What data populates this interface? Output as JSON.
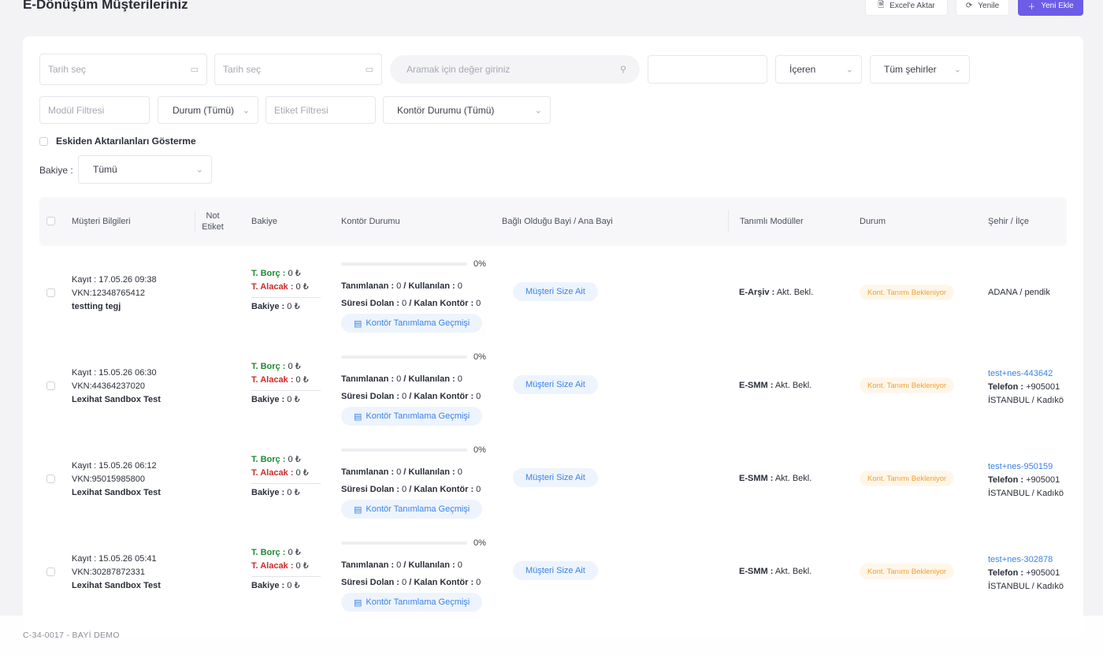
{
  "header": {
    "title": "E-Dönüşüm Müşterileriniz",
    "excel_label": "Excel'e Aktar",
    "refresh_label": "Yenile",
    "add_label": "Yeni Ekle"
  },
  "filters": {
    "date1_placeholder": "Tarih seç",
    "date2_placeholder": "Tarih seç",
    "search_placeholder": "Aramak için değer giriniz",
    "text_value": "",
    "match_mode": "İçeren",
    "city": "Tüm şehirler",
    "module_placeholder": "Modül Filtresi",
    "status": "Durum (Tümü)",
    "tag_placeholder": "Etiket Filtresi",
    "kontor_status": "Kontör Durumu (Tümü)",
    "hide_old_label": "Eskiden Aktarılanları Gösterme",
    "bakiye_label": "Bakiye :",
    "bakiye_value": "Tümü"
  },
  "table": {
    "columns": {
      "customer": "Müşteri Bilgileri",
      "note_tag": "Not Etiket",
      "balance": "Bakiye",
      "kontor": "Kontör Durumu",
      "dealer": "Bağlı Olduğu Bayi / Ana Bayi",
      "modules": "Tanımlı Modüller",
      "status": "Durum",
      "city": "Şehir / İlçe"
    },
    "labels": {
      "borc": "T. Borç :",
      "alacak": "T. Alacak :",
      "bakiye": "Bakiye :",
      "tanimlanan": "Tanımlanan :",
      "kullanilan": "/ Kullanılan :",
      "suresi_dolan": "Süresi Dolan :",
      "kalan": "/ Kalan Kontör :",
      "history_btn": "Kontör Tanımlama Geçmişi",
      "dealer_pill": "Müşteri Size Ait",
      "status_pill": "Kont. Tanımı Bekleniyor",
      "phone_label": "Telefon :"
    },
    "rows": [
      {
        "kayit": "Kayıt : 17.05.26 09:38",
        "vkn": "VKN:12348765412",
        "name": "testting tegj",
        "borc": "0 ₺",
        "alacak": "0 ₺",
        "bakiye": "0 ₺",
        "percent_text": "0%",
        "percent": 0,
        "tanimlanan": "0",
        "kullanilan": "0",
        "suresi_dolan": "0",
        "kalan": "0",
        "module_name": "E-Arşiv :",
        "module_status": "Akt. Bekl.",
        "city": "ADANA / pendik",
        "email": "",
        "phone": ""
      },
      {
        "kayit": "Kayıt : 15.05.26 06:30",
        "vkn": "VKN:44364237020",
        "name": "Lexihat Sandbox Test",
        "borc": "0 ₺",
        "alacak": "0 ₺",
        "bakiye": "0 ₺",
        "percent_text": "0%",
        "percent": 0,
        "tanimlanan": "0",
        "kullanilan": "0",
        "suresi_dolan": "0",
        "kalan": "0",
        "module_name": "E-SMM :",
        "module_status": "Akt. Bekl.",
        "city": "İSTANBUL / Kadıkö",
        "email": "test+nes-443642",
        "phone": "+905001"
      },
      {
        "kayit": "Kayıt : 15.05.26 06:12",
        "vkn": "VKN:95015985800",
        "name": "Lexihat Sandbox Test",
        "borc": "0 ₺",
        "alacak": "0 ₺",
        "bakiye": "0 ₺",
        "percent_text": "0%",
        "percent": 0,
        "tanimlanan": "0",
        "kullanilan": "0",
        "suresi_dolan": "0",
        "kalan": "0",
        "module_name": "E-SMM :",
        "module_status": "Akt. Bekl.",
        "city": "İSTANBUL / Kadıkö",
        "email": "test+nes-950159",
        "phone": "+905001"
      },
      {
        "kayit": "Kayıt : 15.05.26 05:41",
        "vkn": "VKN:30287872331",
        "name": "Lexihat Sandbox Test",
        "borc": "0 ₺",
        "alacak": "0 ₺",
        "bakiye": "0 ₺",
        "percent_text": "0%",
        "percent": 0,
        "tanimlanan": "0",
        "kullanilan": "0",
        "suresi_dolan": "0",
        "kalan": "0",
        "module_name": "E-SMM :",
        "module_status": "Akt. Bekl.",
        "city": "İSTANBUL / Kadıkö",
        "email": "test+nes-302878",
        "phone": "+905001"
      }
    ]
  },
  "footer": {
    "text": "C-34-0017 - BAYİ DEMO"
  }
}
